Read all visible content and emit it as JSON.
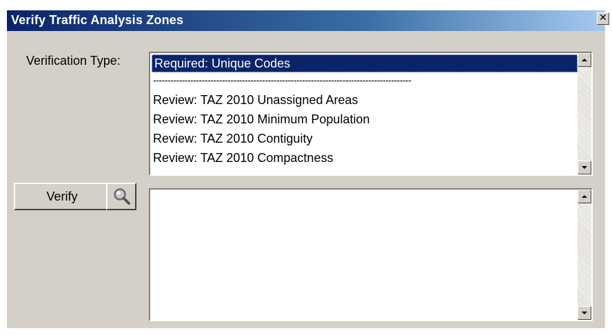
{
  "window": {
    "title": "Verify Traffic Analysis Zones",
    "close_glyph": "✕"
  },
  "verification": {
    "label": "Verification Type:",
    "options": [
      "Required: Unique Codes",
      "------------------------------------------------------------------------------------------",
      "Review: TAZ 2010 Unassigned Areas",
      "Review: TAZ 2010 Minimum Population",
      "Review: TAZ 2010 Contiguity",
      "Review: TAZ 2010 Compactness"
    ],
    "selected_index": 0
  },
  "actions": {
    "verify_label": "Verify",
    "zoom_icon": "magnifier-icon"
  },
  "results": {
    "text": ""
  },
  "colors": {
    "title_start": "#0a246a",
    "title_end": "#a6caf0",
    "selection": "#0a246a",
    "face": "#d4d0c8"
  }
}
